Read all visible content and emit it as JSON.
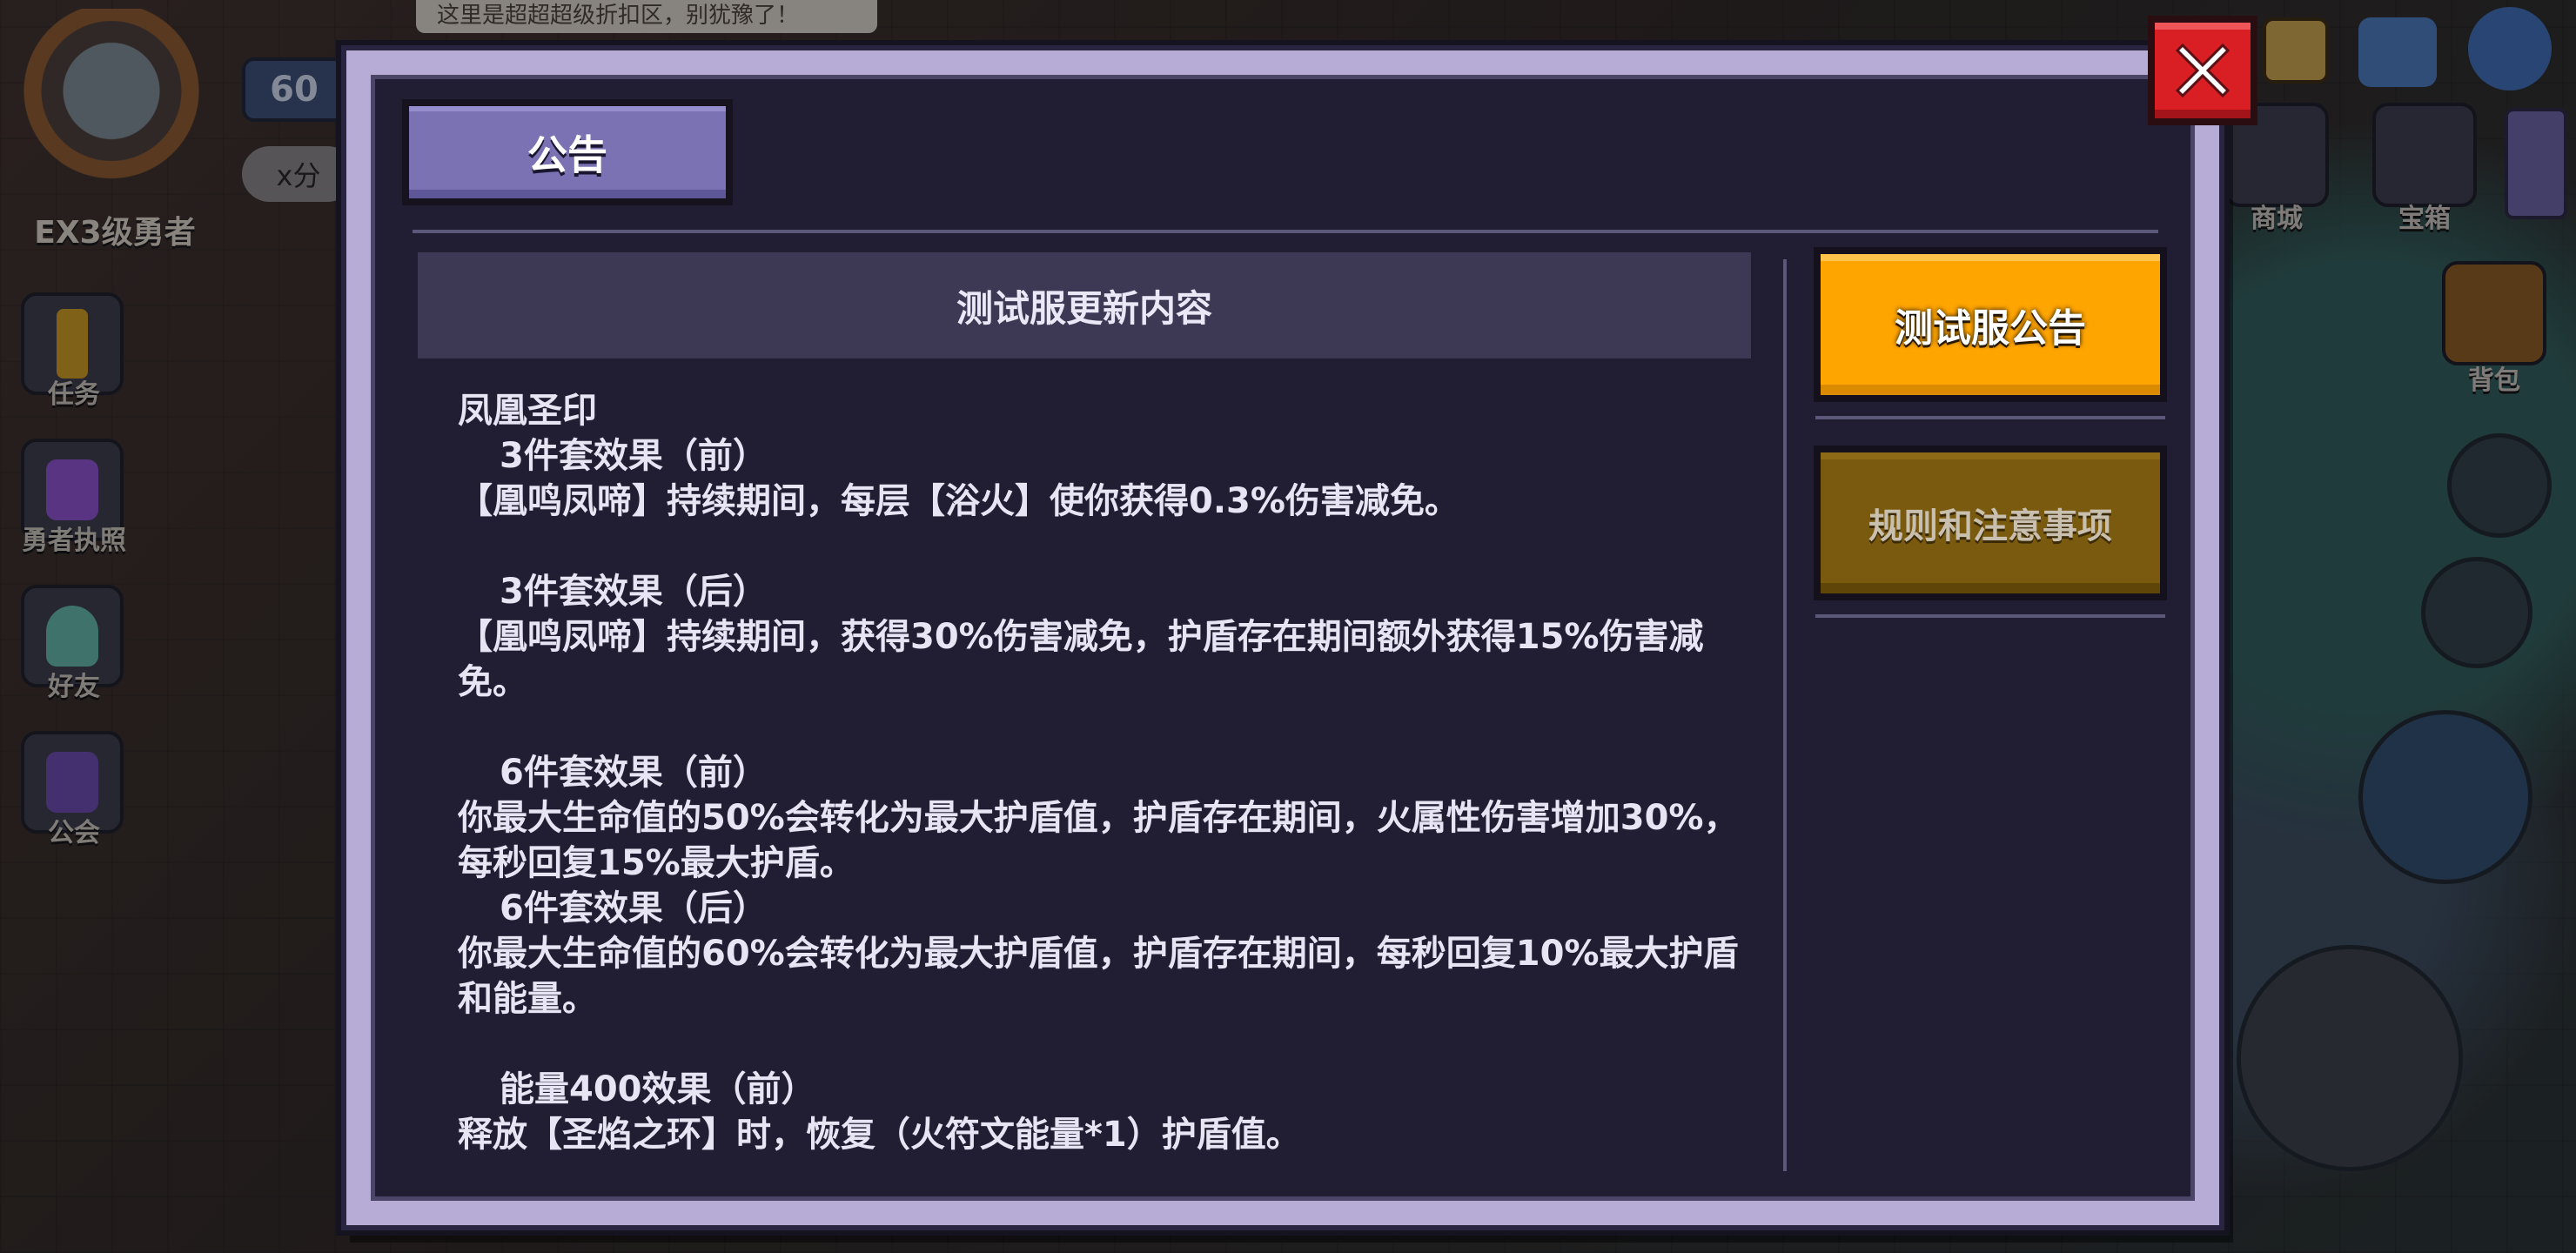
{
  "background": {
    "hero_label": "EX3级勇者",
    "level": "60",
    "score_pill": "x分",
    "top_banner": "这里是超超超级折扣区，别犹豫了！",
    "left_menu": [
      {
        "label": "任务",
        "icon": "quest-exclamation-icon",
        "color": "#c99a1c"
      },
      {
        "label": "勇者执照",
        "icon": "license-badge-icon",
        "color": "#8b4fc8"
      },
      {
        "label": "好友",
        "icon": "friend-ghost-icon",
        "color": "#5fb3a3"
      },
      {
        "label": "公会",
        "icon": "guild-banner-icon",
        "color": "#6a4aa8"
      }
    ],
    "right_menu": [
      {
        "label": "商城",
        "icon": "shop-bunny-icon"
      },
      {
        "label": "宝箱",
        "icon": "treasure-chest-icon"
      },
      {
        "label": "背包",
        "icon": "backpack-icon"
      }
    ]
  },
  "modal": {
    "title": "公告",
    "content_header": "测试服更新内容",
    "tabs": [
      {
        "label": "测试服公告",
        "active": true
      },
      {
        "label": "规则和注意事项",
        "active": false
      }
    ],
    "close_icon": "close-x-icon",
    "lines": [
      {
        "text": "凤凰圣印",
        "indent": false
      },
      {
        "text": "3件套效果（前）",
        "indent": true
      },
      {
        "text": "【凰鸣凤啼】持续期间，每层【浴火】使你获得0.3%伤害减免。",
        "indent": false
      },
      {
        "text": "",
        "indent": false
      },
      {
        "text": "3件套效果（后）",
        "indent": true
      },
      {
        "text": "【凰鸣凤啼】持续期间，获得30%伤害减免，护盾存在期间额外获得15%伤害减免。",
        "indent": false
      },
      {
        "text": "",
        "indent": false
      },
      {
        "text": "6件套效果（前）",
        "indent": true
      },
      {
        "text": "你最大生命值的50%会转化为最大护盾值，护盾存在期间，火属性伤害增加30%，每秒回复15%最大护盾。",
        "indent": false
      },
      {
        "text": "6件套效果（后）",
        "indent": true
      },
      {
        "text": "你最大生命值的60%会转化为最大护盾值，护盾存在期间，每秒回复10%最大护盾和能量。",
        "indent": false
      },
      {
        "text": "",
        "indent": false
      },
      {
        "text": "能量400效果（前）",
        "indent": true
      },
      {
        "text": "释放【圣焰之环】时，恢复（火符文能量*1）护盾值。",
        "indent": false
      }
    ]
  }
}
